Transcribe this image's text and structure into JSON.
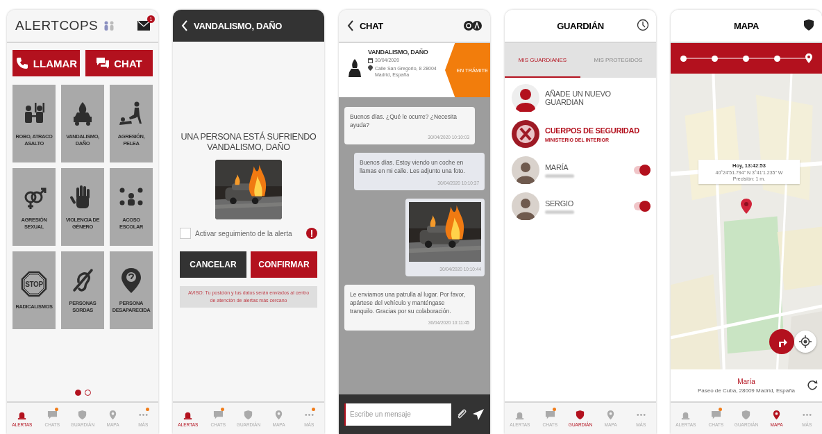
{
  "screens": [
    {
      "kind": "home",
      "logo": "ALERTCOPS",
      "mail_badge": "1",
      "actions": [
        "LLAMAR",
        "CHAT"
      ],
      "alerts": [
        {
          "label": "ROBO, ATRACO ASALTO"
        },
        {
          "label": "VANDALISMO, DAÑO"
        },
        {
          "label": "AGRESIÓN, PELEA"
        },
        {
          "label": "AGRESIÓN SEXUAL"
        },
        {
          "label": "VIOLENCIA DE GÉNERO"
        },
        {
          "label": "ACOSO ESCOLAR"
        },
        {
          "label": "RADICALISMOS",
          "sign": "STOP"
        },
        {
          "label": "PERSONAS SORDAS"
        },
        {
          "label": "PERSONA DESAPARECIDA"
        }
      ],
      "pager": [
        {
          "selected": true
        },
        {
          "selected": false
        }
      ],
      "nav": [
        {
          "label": "ALERTAS",
          "selected": true,
          "badge": false
        },
        {
          "label": "CHATS",
          "selected": false,
          "badge": true
        },
        {
          "label": "GUARDIÁN",
          "selected": false,
          "badge": false
        },
        {
          "label": "MAPA",
          "selected": false,
          "badge": false
        },
        {
          "label": "MÁS",
          "selected": false,
          "badge": true
        }
      ]
    },
    {
      "kind": "confirm",
      "title": "VANDALISMO, DAÑO",
      "heading": "UNA PERSONA ESTÁ SUFRIENDO VANDALISMO, DAÑO",
      "tracking": {
        "label": "Activar seguimiento de la alerta",
        "checked": false
      },
      "buttons": [
        "CANCELAR",
        "CONFIRMAR"
      ],
      "notice": "AVISO: Tu posición y tus datos serán enviados al centro de atención de alertas más cercano",
      "nav": [
        {
          "label": "ALERTAS",
          "selected": true,
          "badge": false
        },
        {
          "label": "CHATS",
          "selected": false,
          "badge": true
        },
        {
          "label": "GUARDIÁN",
          "selected": false,
          "badge": false
        },
        {
          "label": "MAPA",
          "selected": false,
          "badge": false
        },
        {
          "label": "MÁS",
          "selected": false,
          "badge": true
        }
      ]
    },
    {
      "kind": "chat",
      "title": "CHAT",
      "case": {
        "title": "VANDALISMO, DAÑO",
        "date": "30/04/2020",
        "address": "Calle San Gregorio, 8 28004 Madrid, España",
        "status": "EN TRÁMITE"
      },
      "messages": [
        {
          "kind": "text",
          "sent": false,
          "text": "Buenos días. ¿Qué le ocurre? ¿Necesita ayuda?",
          "time": "30/04/2020 10:10:03"
        },
        {
          "kind": "text",
          "sent": true,
          "text": "Buenos días. Estoy viendo un coche en llamas en mi calle. Les adjunto una foto.",
          "time": "30/04/2020 10:10:37"
        },
        {
          "kind": "picture",
          "sent": true,
          "time": "30/04/2020 10:10:44"
        },
        {
          "kind": "text",
          "sent": false,
          "text": "Le enviamos una patrulla al lugar. Por favor, apártese del vehículo y manténgase tranquilo. Gracias por su colaboración.",
          "time": "30/04/2020 10:11:45"
        }
      ],
      "input": {
        "placeholder": "Escribe un mensaje"
      }
    },
    {
      "kind": "guardian",
      "title": "GUARDIÁN",
      "tabs": [
        {
          "label": "MIS GUARDIANES",
          "selected": true
        },
        {
          "label": "MIS PROTEGIDOS",
          "selected": false
        }
      ],
      "items": [
        {
          "kind": "add",
          "name": "AÑADE UN NUEVO GUARDIAN"
        },
        {
          "kind": "official",
          "name": "CUERPOS DE SEGURIDAD",
          "subtitle": "MINISTERIO DEL INTERIOR"
        },
        {
          "kind": "contact",
          "name": "MARÍA",
          "on": true
        },
        {
          "kind": "contact",
          "name": "SERGIO",
          "on": true
        }
      ],
      "nav": [
        {
          "label": "ALERTAS",
          "selected": false,
          "badge": false
        },
        {
          "label": "CHATS",
          "selected": false,
          "badge": true
        },
        {
          "label": "GUARDIÁN",
          "selected": true,
          "badge": false
        },
        {
          "label": "MAPA",
          "selected": false,
          "badge": false
        },
        {
          "label": "MÁS",
          "selected": false,
          "badge": false
        }
      ]
    },
    {
      "kind": "map",
      "title": "MAPA",
      "timeline": [
        {
          "selected": false
        },
        {
          "selected": false
        },
        {
          "selected": false
        },
        {
          "selected": false
        },
        {
          "selected": true
        }
      ],
      "popup": {
        "time": "Hoy, 13:42:53",
        "coords": "40°24'51.794\" N 3°41'1.235\" W",
        "precision": "Precisión: 1 m."
      },
      "footer": {
        "name": "María",
        "address": "Paseo de Cuba, 28009 Madrid, España"
      },
      "nav": [
        {
          "label": "ALERTAS",
          "selected": false,
          "badge": false
        },
        {
          "label": "CHATS",
          "selected": false,
          "badge": true
        },
        {
          "label": "GUARDIÁN",
          "selected": false,
          "badge": false
        },
        {
          "label": "MAPA",
          "selected": true,
          "badge": false
        },
        {
          "label": "MÁS",
          "selected": false,
          "badge": false
        }
      ]
    }
  ]
}
